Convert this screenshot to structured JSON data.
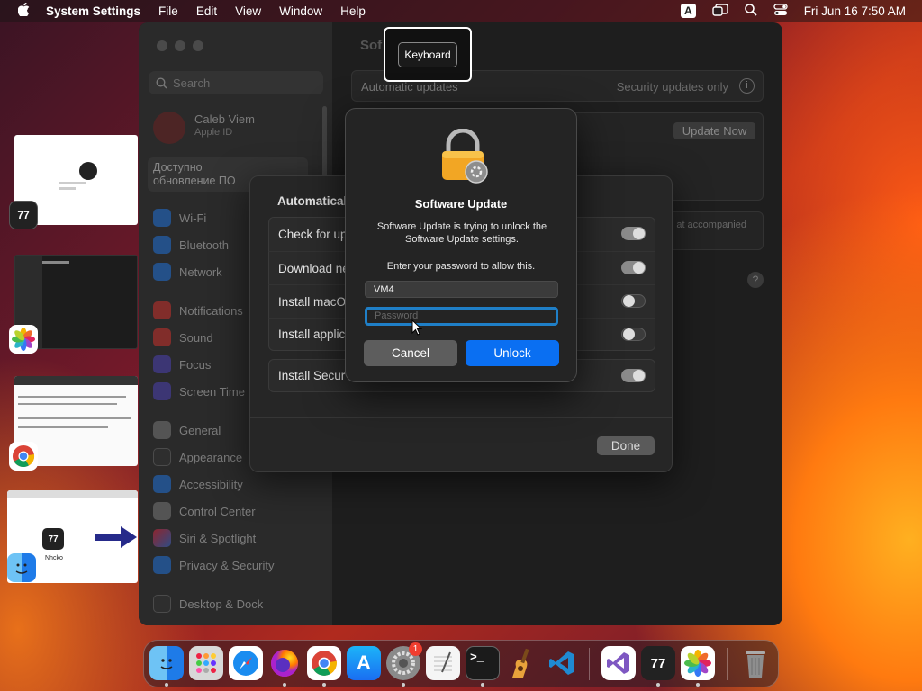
{
  "menubar": {
    "app_name": "System Settings",
    "menus": [
      "File",
      "Edit",
      "View",
      "Window",
      "Help"
    ],
    "input_source": "A",
    "date_time": "Fri Jun 16  7:50 AM"
  },
  "tooltip": {
    "label": "Keyboard"
  },
  "settings": {
    "search_placeholder": "Search",
    "user_name": "Caleb Viem",
    "user_sub": "Apple ID",
    "update_notice": "Доступно обновление ПО",
    "sidebar_items": [
      "Wi-Fi",
      "Bluetooth",
      "Network",
      "Notifications",
      "Sound",
      "Focus",
      "Screen Time",
      "General",
      "Appearance",
      "Accessibility",
      "Control Center",
      "Siri & Spotlight",
      "Privacy & Security",
      "Desktop & Dock"
    ],
    "header_title": "Sof",
    "automatic_updates_label": "Automatic updates",
    "automatic_updates_value": "Security updates only",
    "update_now": "Update Now",
    "accompanied_text": "at accompanied"
  },
  "sheet": {
    "title": "Automatical",
    "rows": [
      "Check for up",
      "Download ne",
      "Install macO",
      "Install applic",
      "Install Secur"
    ],
    "done": "Done"
  },
  "dialog": {
    "title": "Software Update",
    "message": "Software Update is trying to unlock the Software Update settings.",
    "prompt": "Enter your password to allow this.",
    "username_value": "VM4",
    "password_placeholder": "Password",
    "cancel": "Cancel",
    "unlock": "Unlock"
  },
  "thumbnails": {
    "last_label": "Nhcko"
  },
  "dock": {
    "settings_badge": "1"
  },
  "colors": {
    "accent": "#0a6ff2",
    "focus_ring": "#1f7fc7"
  }
}
